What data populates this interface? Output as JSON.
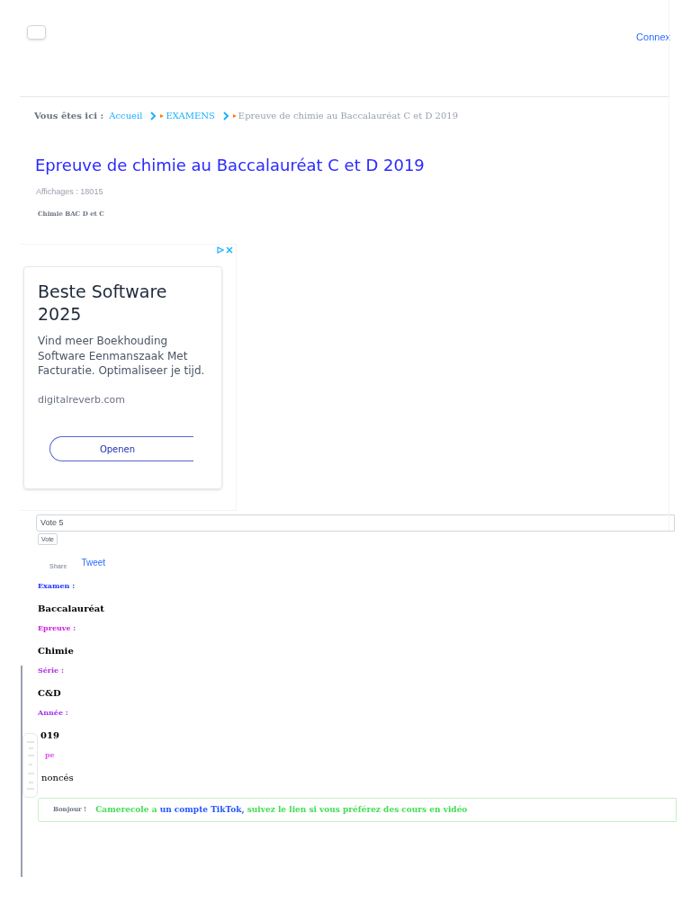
{
  "header": {
    "checkbox": {
      "checked": false
    },
    "login_link": "Connex"
  },
  "breadcrumb": {
    "prefix": "Vous êtes ici :",
    "items": [
      {
        "label": "Accueil",
        "current": false
      },
      {
        "label": "EXAMENS",
        "current": false
      },
      {
        "label": "Epreuve de chimie au Baccalauréat C et D 2019",
        "current": true
      }
    ]
  },
  "title": "Epreuve de chimie au Baccalauréat C et D 2019",
  "views": "Affichages : 18015",
  "tag": "Chimie BAC D et C",
  "ad": {
    "title": "Beste Software 2025",
    "text": "Vind meer Boekhouding Software Eenmanszaak Met Facturatie. Optimaliseer je tijd.",
    "domain": "digitalreverb.com",
    "button": "Openen"
  },
  "vote": {
    "value": "Vote 5",
    "button": "Vote"
  },
  "share": {
    "share": "Share",
    "tweet": "Tweet"
  },
  "fields": [
    {
      "label": "Examen :",
      "value": "Baccalauréat",
      "color": "#2233ff"
    },
    {
      "label": "Epreuve :",
      "value": "Chimie",
      "color": "#cc22dd"
    },
    {
      "label": "Série :",
      "value": "C&D",
      "color": "#b033e0"
    },
    {
      "label": "Année :",
      "value": "019",
      "color": "#a033e8"
    },
    {
      "label": "pe",
      "value": "noncés",
      "color": "#e055f0"
    }
  ],
  "notice": {
    "label": "Bonjour !",
    "before": "Camerecole a",
    "link": "un compte TikTok,",
    "after": "suivez le lien si vous préférez des cours en vidéo"
  }
}
